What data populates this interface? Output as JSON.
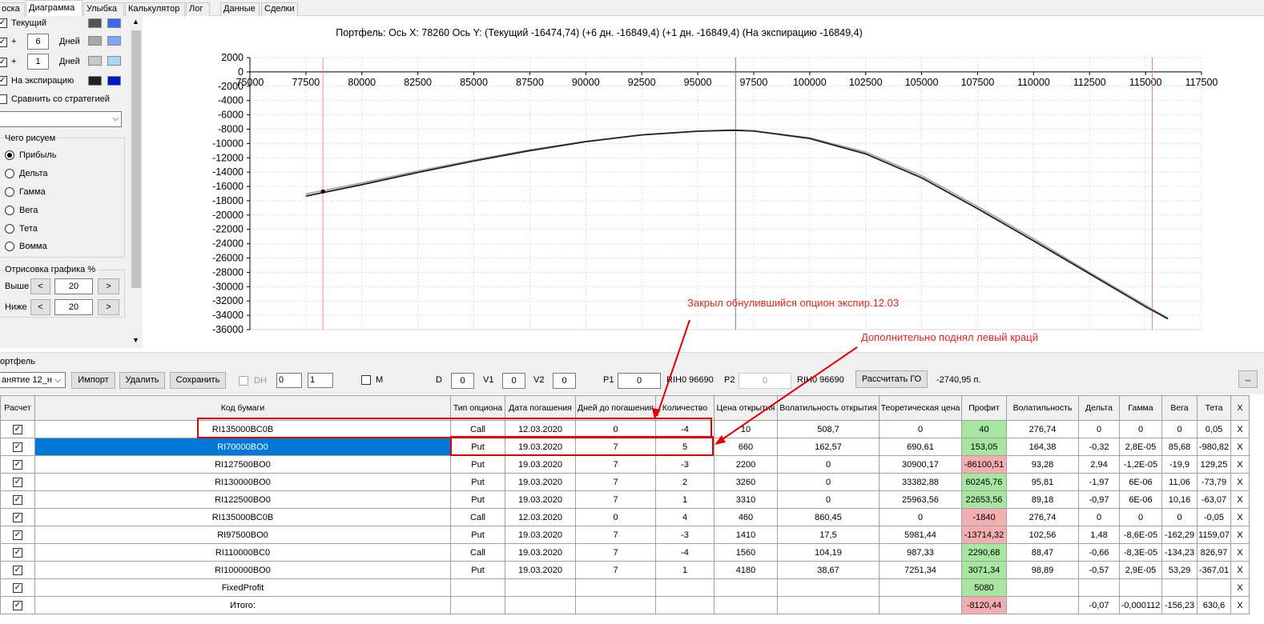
{
  "tabs": [
    "оска",
    "Диаграмма",
    "Улыбка",
    "Калькулятор",
    "Лог",
    "Данные",
    "Сделки"
  ],
  "sidebar": {
    "rows": [
      {
        "label": "Текущий",
        "checked": true
      },
      {
        "label": "Дней",
        "days": "6",
        "prefix": "+",
        "checked": true
      },
      {
        "label": "Дней",
        "days": "1",
        "prefix": "+",
        "checked": true
      },
      {
        "label": "На экспирацию",
        "checked": true
      }
    ],
    "swatches": [
      [
        "#555555",
        "#3a68f0"
      ],
      [
        "#a8a8a8",
        "#7fa5f5"
      ],
      [
        "#c8c8c8",
        "#a8d8f8"
      ],
      [
        "#222222",
        "#0016c8"
      ]
    ],
    "compare_label": "Сравнить со стратегией",
    "what_group": "Чего рисуем",
    "radios": [
      "Прибыль",
      "Дельта",
      "Гамма",
      "Вега",
      "Тета",
      "Вомма"
    ],
    "selected_radio": 0,
    "draw_group": "Отрисовка графика %",
    "above_label": "Выше",
    "above_value": "20",
    "below_label": "Ниже",
    "below_value": "20",
    "dec": "<",
    "inc": ">"
  },
  "chart_data": {
    "type": "line",
    "title": "Портфель: Ось X: 78260 Ось Y:   (Текущий -16474,74)  (+6 дн. -16849,4)  (+1 дн. -16849,4)  (На экспирацию -16849,4)",
    "xlim": [
      75000,
      117500
    ],
    "ylim": [
      -36000,
      2000
    ],
    "x_ticks": [
      75000,
      77500,
      80000,
      82500,
      85000,
      87500,
      90000,
      92500,
      95000,
      97500,
      100000,
      102500,
      105000,
      107500,
      110000,
      112500,
      115000,
      117500
    ],
    "y_ticks": [
      2000,
      0,
      -2000,
      -4000,
      -6000,
      -8000,
      -10000,
      -12000,
      -14000,
      -16000,
      -18000,
      -20000,
      -22000,
      -24000,
      -26000,
      -28000,
      -30000,
      -32000,
      -34000,
      -36000
    ],
    "x_axis_at_y": 0,
    "vlines": [
      {
        "x": 78260,
        "color": "#ff8080"
      },
      {
        "x": 96690,
        "color": "#6b7fa8"
      },
      {
        "x": 115300,
        "color": "#ff8080"
      }
    ],
    "series": [
      {
        "color": "#a8a8a8",
        "x": [
          77500,
          80000,
          82500,
          85000,
          87500,
          90000,
          92500,
          95000,
          96600,
          97500,
          100000,
          102500,
          105000,
          107500,
          110000,
          112500,
          115000,
          116000
        ],
        "y": [
          -17050,
          -15500,
          -13850,
          -12300,
          -10900,
          -9700,
          -8800,
          -8280,
          -8150,
          -8250,
          -9200,
          -11200,
          -14500,
          -18800,
          -23300,
          -28000,
          -32600,
          -34400
        ]
      },
      {
        "color": "#222222",
        "x": [
          77500,
          80000,
          82500,
          85000,
          87500,
          90000,
          92500,
          95000,
          96600,
          97500,
          100000,
          102500,
          105000,
          107500,
          110000,
          112500,
          115000,
          116000
        ],
        "y": [
          -17350,
          -15750,
          -14050,
          -12450,
          -11000,
          -9750,
          -8800,
          -8280,
          -8150,
          -8250,
          -9300,
          -11450,
          -14800,
          -19100,
          -23600,
          -28200,
          -32800,
          -34500
        ]
      }
    ],
    "marker": {
      "x": 78260,
      "y": -16700
    }
  },
  "portfolio": {
    "group_label": "ортфель",
    "select_value": "анятие 12_н",
    "import": "Импорт",
    "delete": "Удалить",
    "save": "Сохранить",
    "dh": "DH",
    "dh_val": "0",
    "spin2_val": "1",
    "m": "M",
    "d": "D",
    "d_val": "0",
    "v1": "V1",
    "v1_val": "0",
    "v2": "V2",
    "v2_val": "0",
    "p1": "P1",
    "p1_val": "0",
    "rih1": "RIH0 96690",
    "p2": "P2",
    "p2_val": "0",
    "rih2": "RIH0 96690",
    "calc_btn": "Рассчитать ГО",
    "go_value": "-2740,95 п.",
    "min_btn": "_"
  },
  "table": {
    "headers": [
      "Расчет",
      "Код бумаги",
      "Тип опциона",
      "Дата погашения",
      "Дней до погашения",
      "Количество",
      "Цена открытия",
      "Волатильность открытия",
      "Теоретическая цена",
      "Профит",
      "Волатильность",
      "Дельта",
      "Гамма",
      "Вега",
      "Тета",
      "X"
    ],
    "rows": [
      [
        "RI135000BC0B",
        "Call",
        "12.03.2020",
        "0",
        "-4",
        "10",
        "508,7",
        "0",
        "40",
        "276,74",
        "0",
        "0",
        "0",
        "0,05"
      ],
      [
        "RI70000BO0",
        "Put",
        "19.03.2020",
        "7",
        "5",
        "660",
        "162,57",
        "690,61",
        "153,05",
        "164,38",
        "-0,32",
        "2,8E-05",
        "85,68",
        "-980,82"
      ],
      [
        "RI127500BO0",
        "Put",
        "19.03.2020",
        "7",
        "-3",
        "2200",
        "0",
        "30900,17",
        "-86100,51",
        "93,28",
        "2,94",
        "-1,2E-05",
        "-19,9",
        "129,25"
      ],
      [
        "RI130000BO0",
        "Put",
        "19.03.2020",
        "7",
        "2",
        "3260",
        "0",
        "33382,88",
        "60245,76",
        "95,81",
        "-1,97",
        "6E-06",
        "11,06",
        "-73,79"
      ],
      [
        "RI122500BO0",
        "Put",
        "19.03.2020",
        "7",
        "1",
        "3310",
        "0",
        "25963,56",
        "22653,56",
        "89,18",
        "-0,97",
        "6E-06",
        "10,16",
        "-63,07"
      ],
      [
        "RI135000BC0B",
        "Call",
        "12.03.2020",
        "0",
        "4",
        "460",
        "860,45",
        "0",
        "-1840",
        "276,74",
        "0",
        "0",
        "0",
        "-0,05"
      ],
      [
        "RI97500BO0",
        "Put",
        "19.03.2020",
        "7",
        "-3",
        "1410",
        "17,5",
        "5981,44",
        "-13714,32",
        "102,56",
        "1,48",
        "-8,6E-05",
        "-162,29",
        "1159,07"
      ],
      [
        "RI110000BC0",
        "Call",
        "19.03.2020",
        "7",
        "-4",
        "1560",
        "104,19",
        "987,33",
        "2290,68",
        "88,47",
        "-0,66",
        "-8,3E-05",
        "-134,23",
        "826,97"
      ],
      [
        "RI100000BO0",
        "Put",
        "19.03.2020",
        "7",
        "1",
        "4180",
        "38,67",
        "7251,34",
        "3071,34",
        "98,89",
        "-0,57",
        "2,9E-05",
        "53,29",
        "-367,01"
      ],
      [
        "FixedProfit",
        "",
        "",
        "",
        "",
        "",
        "",
        "",
        "5080",
        "",
        "",
        "",
        "",
        ""
      ],
      [
        "Итого:",
        "",
        "",
        "",
        "",
        "",
        "",
        "",
        "-8120,44",
        "",
        "-0,07",
        "-0,000112",
        "-156,23",
        "630,6"
      ]
    ],
    "profit_status": [
      "g",
      "g",
      "r",
      "g",
      "g",
      "r",
      "r",
      "g",
      "g",
      "g",
      "r"
    ],
    "selected_row": 1,
    "check": "✓",
    "x_label": "X"
  },
  "annotations": {
    "a1": "Закрыл обнулившийся опцион экспир.12.03",
    "a2": "Дополнительно поднял левый крацй",
    "color": "#e82020"
  }
}
